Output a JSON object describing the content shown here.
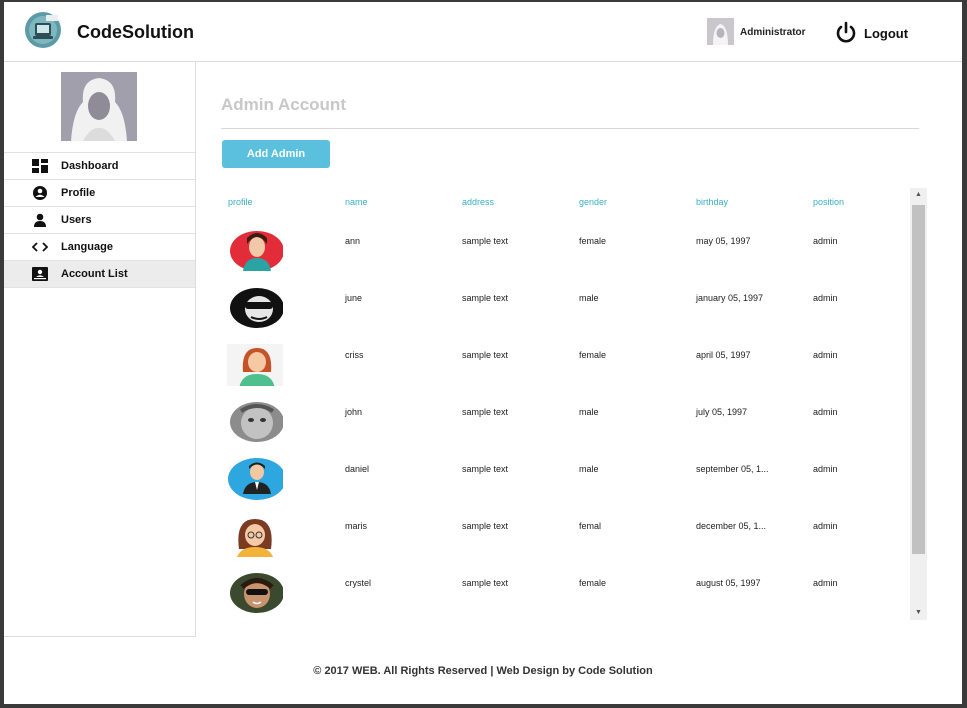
{
  "header": {
    "brand": "CodeSolution",
    "admin_name": "Administrator",
    "logout_label": "Logout"
  },
  "sidebar": {
    "items": [
      {
        "label": "Dashboard",
        "icon": "dashboard-icon"
      },
      {
        "label": "Profile",
        "icon": "profile-icon"
      },
      {
        "label": "Users",
        "icon": "user-icon"
      },
      {
        "label": "Language",
        "icon": "code-icon"
      },
      {
        "label": "Account List",
        "icon": "account-list-icon",
        "active": true
      }
    ]
  },
  "main": {
    "title": "Admin Account",
    "add_button": "Add Admin",
    "columns": [
      "profile",
      "name",
      "address",
      "gender",
      "birthday",
      "position"
    ],
    "rows": [
      {
        "name": "ann",
        "address": "sample text",
        "gender": "female",
        "birthday": "may 05, 1997",
        "position": "admin",
        "avatar": "girl-red-background"
      },
      {
        "name": "june",
        "address": "sample text",
        "gender": "male",
        "birthday": "january 05, 1997",
        "position": "admin",
        "avatar": "man-sunglasses-bw"
      },
      {
        "name": "criss",
        "address": "sample text",
        "gender": "female",
        "birthday": "april 05, 1997",
        "position": "admin",
        "avatar": "cartoon-woman-redhead"
      },
      {
        "name": "john",
        "address": "sample text",
        "gender": "male",
        "birthday": "july 05, 1997",
        "position": "admin",
        "avatar": "man-face-gray"
      },
      {
        "name": "daniel",
        "address": "sample text",
        "gender": "male",
        "birthday": "september 05, 1...",
        "position": "admin",
        "avatar": "cartoon-man-blue-circle"
      },
      {
        "name": "maris",
        "address": "sample text",
        "gender": "femal",
        "birthday": "december 05, 1...",
        "position": "admin",
        "avatar": "cartoon-girl-glasses"
      },
      {
        "name": "crystel",
        "address": "sample text",
        "gender": "female",
        "birthday": "august 05, 1997",
        "position": "admin",
        "avatar": "woman-sunglasses-photo"
      }
    ]
  },
  "footer": {
    "text": "© 2017 WEB. All Rights Reserved | Web Design by Code Solution"
  },
  "colors": {
    "accent": "#5bc0de",
    "column_header": "#39b0c5",
    "title": "#c8c8c8"
  }
}
